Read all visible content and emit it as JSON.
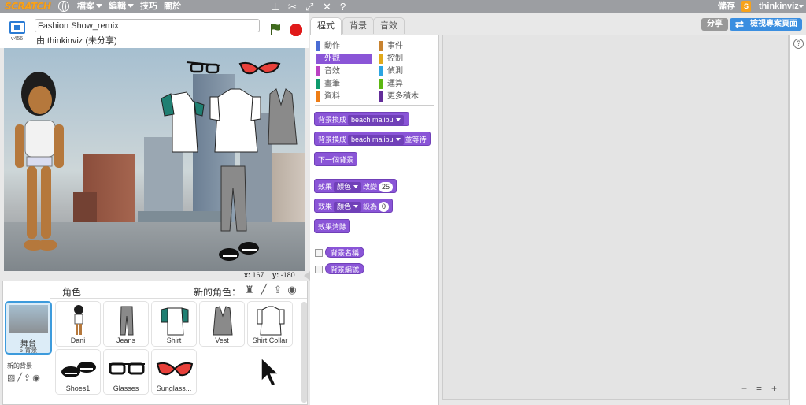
{
  "menubar": {
    "logo": "SCRATCH",
    "menus": [
      "檔案",
      "編輯",
      "技巧",
      "關於"
    ],
    "save": "儲存",
    "avatar": "S",
    "user": "thinkinviz"
  },
  "stage_header": {
    "version": "v456",
    "project_title": "Fashion Show_remix",
    "byline": "由 thinkinviz (未分享)"
  },
  "coords": {
    "x_label": "x:",
    "x": "167",
    "y_label": "y:",
    "y": "-180"
  },
  "sprite_panel": {
    "header": "角色",
    "new_sprite": "新的角色：",
    "stage_name": "舞台",
    "stage_count": "5 背景",
    "new_backdrop": "新的背景",
    "sprites": [
      "Dani",
      "Jeans",
      "Shirt",
      "Vest",
      "Shirt Collar",
      "Shoes1",
      "Glasses",
      "Sunglass..."
    ]
  },
  "tabs": [
    "程式",
    "背景",
    "音效"
  ],
  "categories": [
    {
      "label": "動作",
      "color": "#4a6cd4"
    },
    {
      "label": "事件",
      "color": "#c88330"
    },
    {
      "label": "外觀",
      "color": "#8a55d7"
    },
    {
      "label": "控制",
      "color": "#e1a91a"
    },
    {
      "label": "音效",
      "color": "#bb42c3"
    },
    {
      "label": "偵測",
      "color": "#2ca5e2"
    },
    {
      "label": "畫筆",
      "color": "#0e9a6c"
    },
    {
      "label": "運算",
      "color": "#5cb712"
    },
    {
      "label": "資料",
      "color": "#ee7d16"
    },
    {
      "label": "更多積木",
      "color": "#632d99"
    }
  ],
  "blocks": {
    "switch_backdrop": "背景換成",
    "backdrop_value": "beach malibu",
    "and_wait": "並等待",
    "next_backdrop": "下一個背景",
    "effect": "效果",
    "effect_color": "顏色",
    "change_by": "改變",
    "change_value": "25",
    "set_to": "設為",
    "set_value": "0",
    "clear_effects": "效果清除",
    "backdrop_name": "背景名稱",
    "backdrop_number": "背景編號"
  },
  "buttons": {
    "share": "分享",
    "view_project": "檢視專案頁面",
    "help": "?"
  },
  "zoom": {
    "out": "−",
    "reset": "=",
    "in": "+"
  }
}
